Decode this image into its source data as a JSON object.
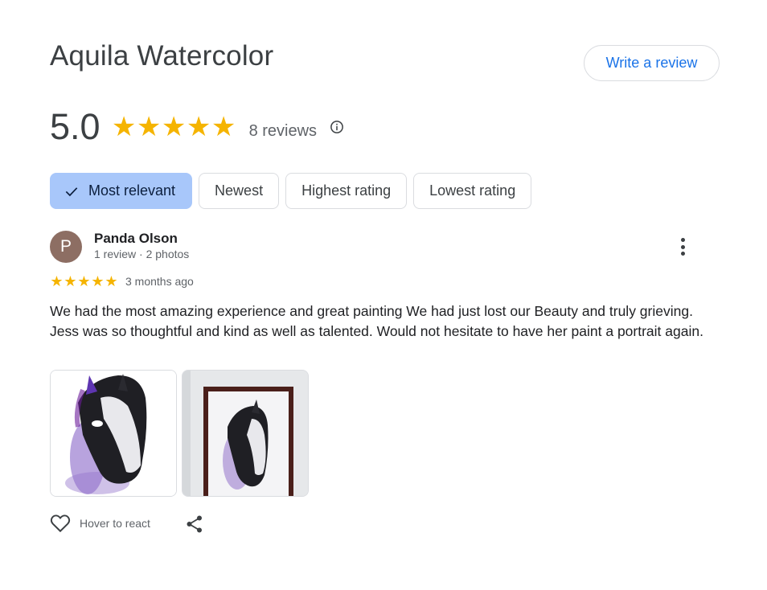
{
  "business": {
    "title": "Aquila Watercolor"
  },
  "actions": {
    "write_review": "Write a review"
  },
  "summary": {
    "rating": "5.0",
    "stars": 5,
    "review_count": "8 reviews",
    "info_icon": "info-icon"
  },
  "sort_chips": [
    {
      "label": "Most relevant",
      "selected": true
    },
    {
      "label": "Newest",
      "selected": false
    },
    {
      "label": "Highest rating",
      "selected": false
    },
    {
      "label": "Lowest rating",
      "selected": false
    }
  ],
  "review": {
    "avatar_letter": "P",
    "name": "Panda Olson",
    "meta": "1 review · 2 photos",
    "stars": 5,
    "time": "3 months ago",
    "text": "We had the most amazing experience and great painting We had just lost our Beauty and truly grieving. Jess was so thoughtful and kind as well as talented. Would not hesitate to have her paint a portrait again.",
    "photos": [
      "horse-watercolor-painting",
      "framed-horse-painting-on-wall"
    ],
    "react_label": "Hover to react"
  },
  "colors": {
    "accent": "#1a73e8",
    "star": "#f5b400",
    "chip_selected": "#a8c7fa",
    "avatar": "#8d6e63"
  }
}
